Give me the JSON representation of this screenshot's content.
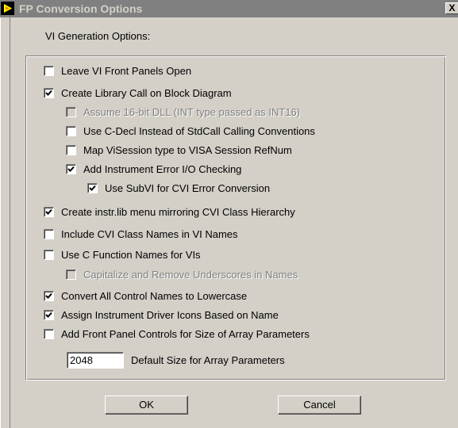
{
  "window": {
    "title": "FP Conversion Options",
    "close_glyph": "X"
  },
  "section_label": "VI Generation Options:",
  "options": [
    {
      "label": "Leave VI Front Panels Open",
      "checked": false,
      "enabled": true
    },
    {
      "label": "Create Library Call on Block Diagram",
      "checked": true,
      "enabled": true
    },
    {
      "label": "Assume 16-bit DLL (INT type passed as INT16)",
      "checked": false,
      "enabled": false
    },
    {
      "label": "Use C-Decl Instead of StdCall Calling Conventions",
      "checked": false,
      "enabled": true
    },
    {
      "label": "Map ViSession type to VISA Session RefNum",
      "checked": false,
      "enabled": true
    },
    {
      "label": "Add Instrument Error I/O Checking",
      "checked": true,
      "enabled": true
    },
    {
      "label": "Use SubVI for CVI Error Conversion",
      "checked": true,
      "enabled": true
    },
    {
      "label": "Create instr.lib menu mirroring CVI Class Hierarchy",
      "checked": true,
      "enabled": true
    },
    {
      "label": "Include CVI Class Names in VI Names",
      "checked": false,
      "enabled": true
    },
    {
      "label": "Use C Function Names for VIs",
      "checked": false,
      "enabled": true
    },
    {
      "label": "Capitalize and Remove Underscores in Names",
      "checked": false,
      "enabled": false
    },
    {
      "label": "Convert All Control Names to Lowercase",
      "checked": true,
      "enabled": true
    },
    {
      "label": "Assign Instrument Driver Icons Based on Name",
      "checked": true,
      "enabled": true
    },
    {
      "label": "Add Front Panel Controls for Size of Array Parameters",
      "checked": false,
      "enabled": true
    }
  ],
  "array_size": {
    "value": "2048",
    "label": "Default Size for Array Parameters"
  },
  "buttons": {
    "ok": "OK",
    "cancel": "Cancel"
  },
  "icons": {
    "title": "labview-vi-icon",
    "check": "checkmark-icon"
  }
}
